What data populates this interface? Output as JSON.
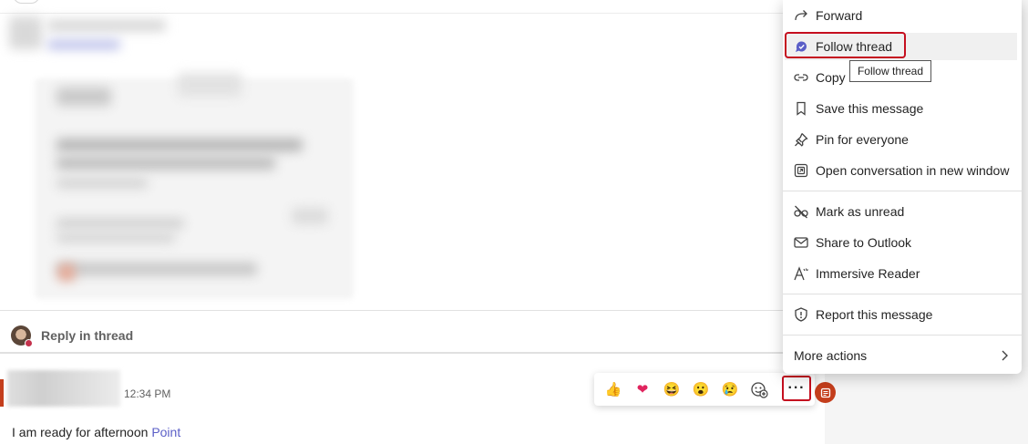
{
  "context_menu": {
    "items": [
      {
        "label": "Forward",
        "icon": "forward-icon"
      },
      {
        "label": "Follow thread",
        "icon": "follow-thread-icon"
      },
      {
        "label": "Copy",
        "icon": "link-icon"
      },
      {
        "label": "Save this message",
        "icon": "bookmark-icon"
      },
      {
        "label": "Pin for everyone",
        "icon": "pin-icon"
      },
      {
        "label": "Open conversation in new window",
        "icon": "open-window-icon"
      },
      {
        "label": "Mark as unread",
        "icon": "unread-icon"
      },
      {
        "label": "Share to Outlook",
        "icon": "mail-icon"
      },
      {
        "label": "Immersive Reader",
        "icon": "immersive-reader-icon"
      },
      {
        "label": "Report this message",
        "icon": "shield-icon"
      }
    ],
    "more_actions": "More actions",
    "hovered_item": "Follow thread"
  },
  "tooltip": "Follow thread",
  "thread": {
    "reply_label": "Reply in thread"
  },
  "message": {
    "time": "12:34 PM",
    "text": "I am ready for afternoon ",
    "link": "Point"
  },
  "reactions": {
    "items": [
      {
        "name": "like",
        "glyph": "👍"
      },
      {
        "name": "heart",
        "glyph": "❤"
      },
      {
        "name": "laugh",
        "glyph": "😆"
      },
      {
        "name": "surprised",
        "glyph": "😮"
      },
      {
        "name": "sad",
        "glyph": "😢"
      }
    ],
    "more_glyph": "···"
  },
  "colors": {
    "accent": "#5b5fc7",
    "highlight_border": "#c50f1f",
    "loop_badge": "#c43e1c"
  }
}
